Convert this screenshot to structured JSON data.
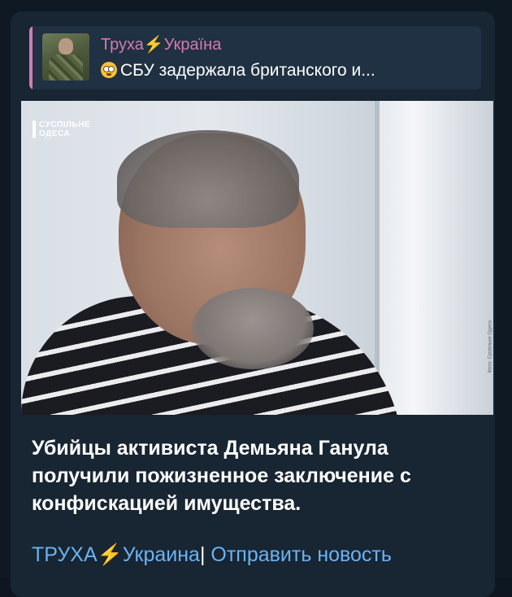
{
  "forwarded": {
    "channel_name_part1": "Труха",
    "channel_name_bolt": "⚡",
    "channel_name_part2": "Україна",
    "preview_text": "СБУ задержала британского и..."
  },
  "photo": {
    "logo_line1": "СУСПІЛЬНЕ",
    "logo_line2": "ОДЕСА",
    "credit": "Фото: Суспільне Одеса"
  },
  "message": {
    "caption": "Убийцы активиста Демьяна Ганула получили пожизненное заключение с конфискацией имущества.",
    "footer_link_part1": "ТРУХА",
    "footer_bolt": "⚡",
    "footer_link_part2": "Украина",
    "footer_separator": "|",
    "footer_link2": " Отправить новость"
  },
  "colors": {
    "background": "#0e1621",
    "bubble": "#182533",
    "reply_accent": "#d67ab1",
    "link": "#6ab3f3",
    "bolt": "#f4b43a"
  },
  "icons": {
    "forward_emoji": "flushed-face-icon",
    "bolt": "lightning-icon"
  }
}
